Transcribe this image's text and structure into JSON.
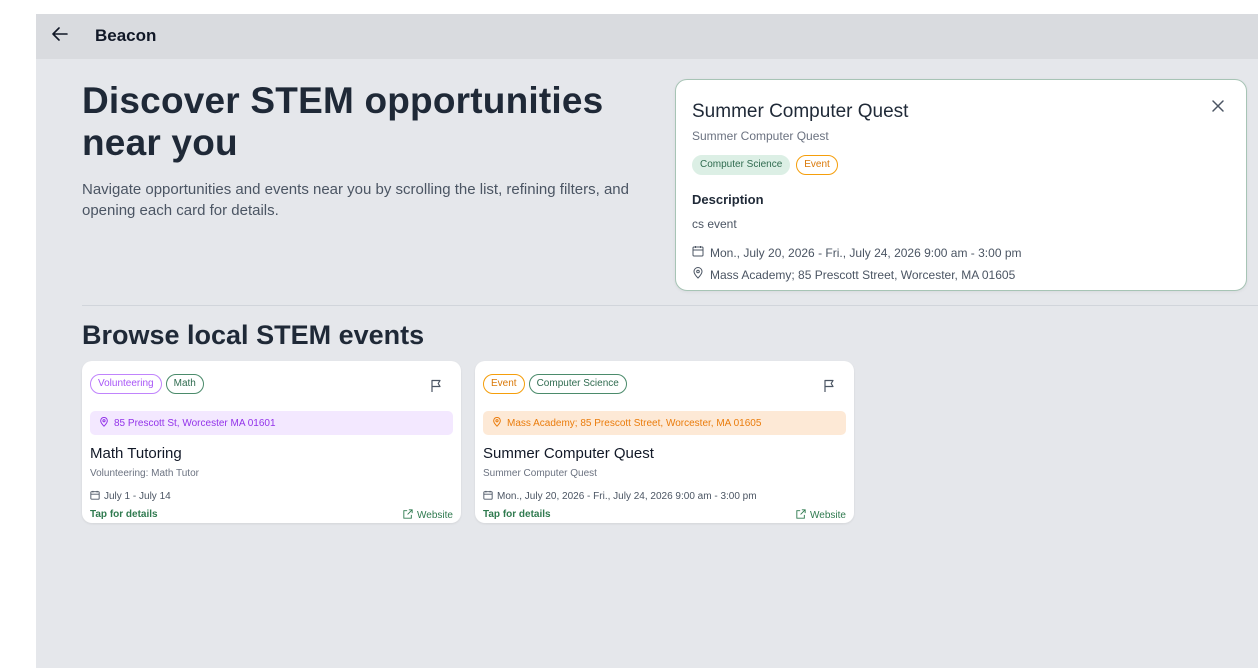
{
  "app": {
    "title": "Beacon"
  },
  "hero": {
    "title": "Discover STEM opportunities near you",
    "description": "Navigate opportunities and events near you by scrolling the list, refining filters, and opening each card for details."
  },
  "detail": {
    "title": "Summer Computer Quest",
    "subtitle": "Summer Computer Quest",
    "tags": [
      "Computer Science",
      "Event"
    ],
    "description_label": "Description",
    "description": "cs event",
    "date": "Mon., July 20, 2026 - Fri., July 24, 2026 9:00 am - 3:00 pm",
    "location": "Mass Academy; 85 Prescott Street, Worcester, MA 01605"
  },
  "section": {
    "title": "Browse local STEM events"
  },
  "cards": [
    {
      "tags": [
        "Volunteering",
        "Math"
      ],
      "location": "85 Prescott St, Worcester MA 01601",
      "title": "Math Tutoring",
      "subtitle": "Volunteering: Math Tutor",
      "date": "July 1 - July 14",
      "tap_label": "Tap for details",
      "website_label": "Website"
    },
    {
      "tags": [
        "Event",
        "Computer Science"
      ],
      "location": "Mass Academy; 85 Prescott Street, Worcester, MA 01605",
      "title": "Summer Computer Quest",
      "subtitle": "Summer Computer Quest",
      "date": "Mon., July 20, 2026 - Fri., July 24, 2026 9:00 am - 3:00 pm",
      "tap_label": "Tap for details",
      "website_label": "Website"
    }
  ],
  "colors": {
    "accent_green": "#2f7a4f",
    "event_orange": "#d97706",
    "volunteer_purple": "#a855f7",
    "background": "#e5e7eb"
  }
}
